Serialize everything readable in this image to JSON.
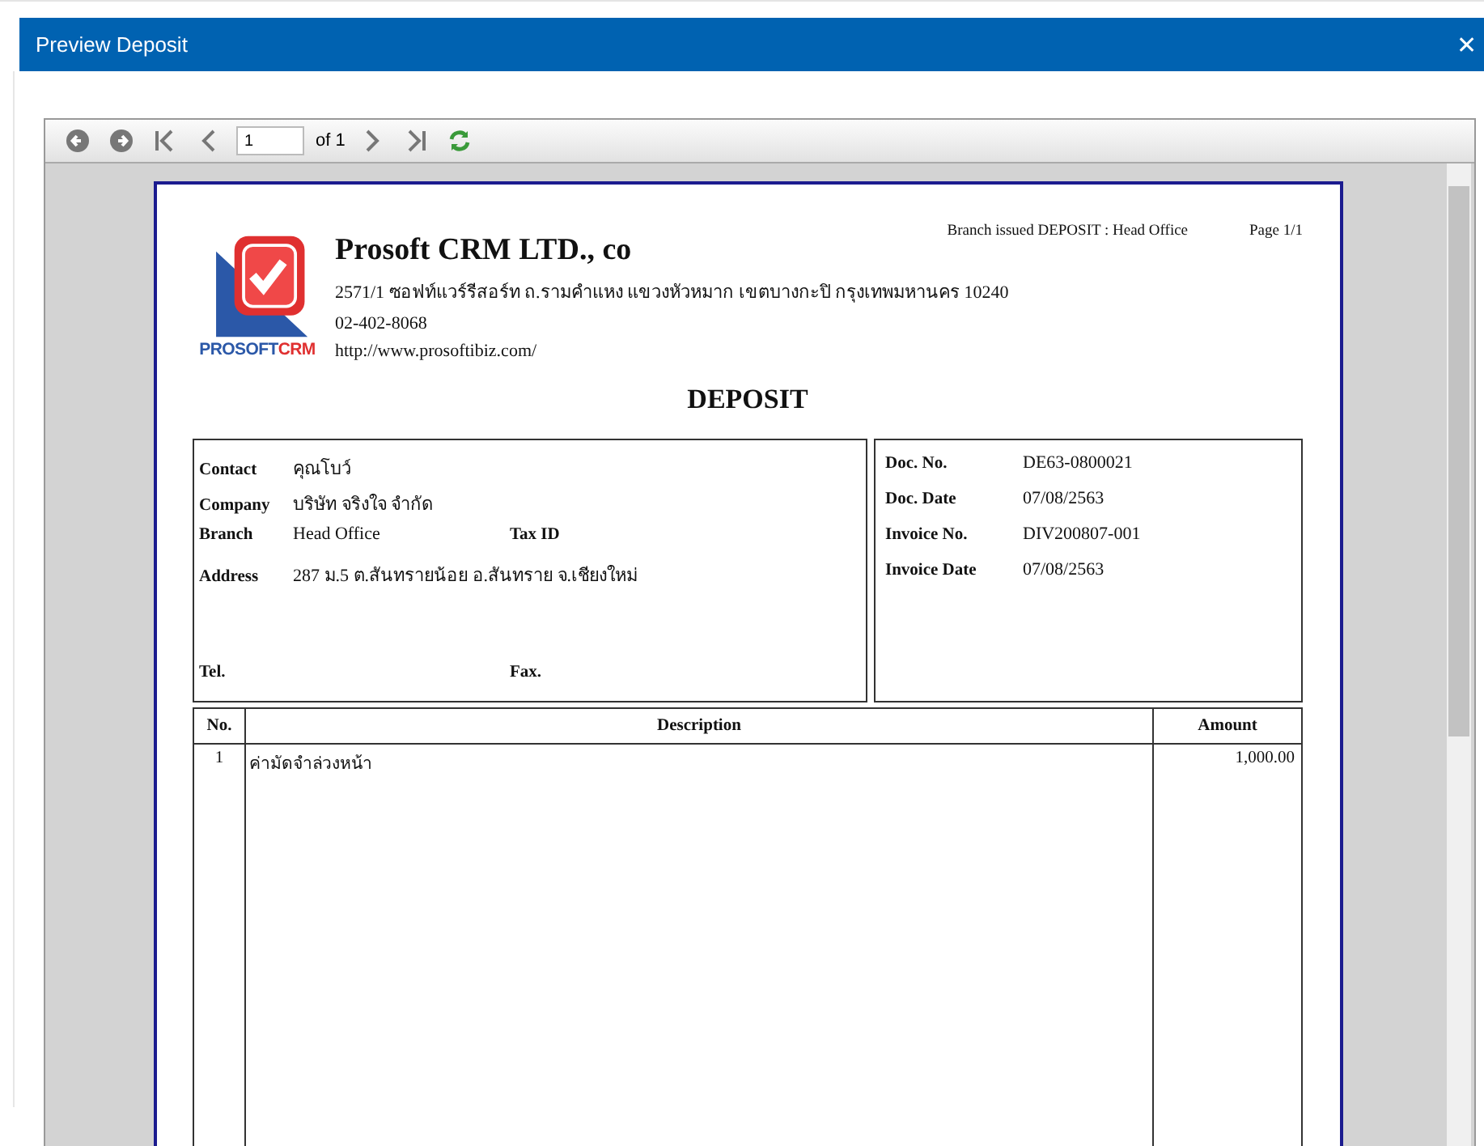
{
  "window": {
    "title": "Preview Deposit",
    "close": "✕"
  },
  "toolbar": {
    "page_input": "1",
    "page_of": "of 1"
  },
  "report": {
    "branch_issued": "Branch issued DEPOSIT : Head Office",
    "page": "Page 1/1",
    "logo": {
      "brand": "PROSOFT",
      "suffix": "CRM"
    },
    "company": "Prosoft CRM LTD., co",
    "address": "2571/1 ซอฟท์แวร์รีสอร์ท ถ.รามคำแหง แขวงหัวหมาก เขตบางกะปิ กรุงเทพมหานคร 10240",
    "phone": "02-402-8068",
    "website": "http://www.prosoftibiz.com/",
    "title": "DEPOSIT",
    "customer": {
      "contact_label": "Contact",
      "contact": "คุณโบว์",
      "company_label": "Company",
      "company": "บริษัท จริงใจ จำกัด",
      "branch_label": "Branch",
      "branch": "Head Office",
      "tax_label": "Tax ID",
      "address_label": "Address",
      "address": "287 ม.5 ต.สันทรายน้อย อ.สันทราย จ.เชียงใหม่",
      "tel_label": "Tel.",
      "fax_label": "Fax."
    },
    "document": [
      {
        "label": "Doc. No.",
        "value": "DE63-0800021"
      },
      {
        "label": "Doc. Date",
        "value": "07/08/2563"
      },
      {
        "label": "Invoice No.",
        "value": "DIV200807-001"
      },
      {
        "label": "Invoice Date",
        "value": "07/08/2563"
      }
    ],
    "table": {
      "columns": [
        "No.",
        "Description",
        "Amount"
      ],
      "rows": [
        {
          "no": "1",
          "description": "ค่ามัดจำล่วงหน้า",
          "amount": "1,000.00"
        }
      ]
    }
  }
}
